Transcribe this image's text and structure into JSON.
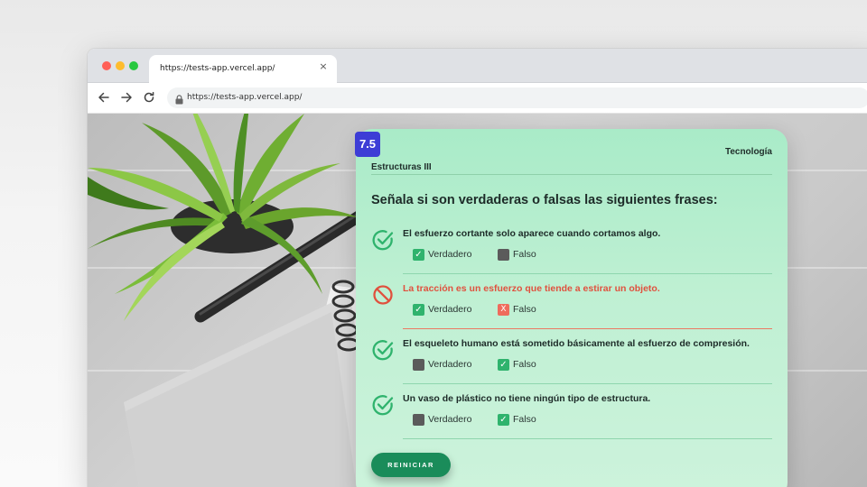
{
  "browser": {
    "tab_title": "https://tests-app.vercel.app/",
    "tab_close": "×",
    "address": "https://tests-app.vercel.app/"
  },
  "quiz": {
    "score": "7.5",
    "category": "Tecnología",
    "topic": "Estructuras III",
    "question": "Señala si son verdaderas o falsas las siguientes frases:",
    "true_label": "Verdadero",
    "false_label": "Falso",
    "reset_label": "REINICIAR",
    "items": [
      {
        "text": "El esfuerzo cortante solo aparece cuando cortamos algo.",
        "status": "correct",
        "selected": "false"
      },
      {
        "text": "La tracción es un esfuerzo que tiende a estirar un objeto.",
        "status": "incorrect",
        "selected": "false"
      },
      {
        "text": "El esqueleto humano está sometido básicamente al esfuerzo de compresión.",
        "status": "correct",
        "selected": "false"
      },
      {
        "text": "Un vaso de plástico no tiene ningún tipo de estructura.",
        "status": "correct",
        "selected": "false"
      }
    ]
  },
  "colors": {
    "card_green": "#bff0d3",
    "correct_green": "#2fb36d",
    "incorrect_red": "#e0513e",
    "score_badge": "#3d3dd6",
    "button": "#1a8c5a"
  }
}
